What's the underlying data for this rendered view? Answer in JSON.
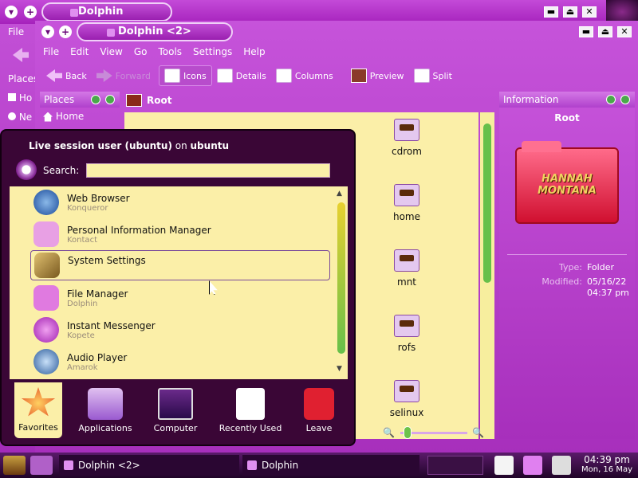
{
  "colors": {
    "accent": "#b42cc8",
    "panel_bg": "#fbefa8",
    "menu_bg": "#3a0636"
  },
  "back_window": {
    "title": "Dolphin",
    "menu_file": "File",
    "places_label": "Places",
    "places_items": [
      "Ho",
      "Ne"
    ]
  },
  "front_window": {
    "title": "Dolphin <2>",
    "menubar": [
      "File",
      "Edit",
      "View",
      "Go",
      "Tools",
      "Settings",
      "Help"
    ],
    "toolbar": {
      "back": "Back",
      "forward": "Forward",
      "icons": "Icons",
      "details": "Details",
      "columns": "Columns",
      "preview": "Preview",
      "split": "Split"
    },
    "places": {
      "title": "Places",
      "items": [
        "Home"
      ]
    },
    "location": "Root",
    "files": [
      "cdrom",
      "home",
      "mnt",
      "rofs",
      "selinux"
    ],
    "info": {
      "title": "Information",
      "name": "Root",
      "thumbnail_text": "HANNAH MONTANA",
      "type_label": "Type:",
      "type_value": "Folder",
      "modified_label": "Modified:",
      "modified_date": "05/16/22",
      "modified_time": "04:37 pm"
    }
  },
  "launcher": {
    "user_line_bold1": "Live session user (ubuntu)",
    "user_line_on": " on ",
    "user_line_bold2": "ubuntu",
    "search_label": "Search:",
    "search_value": "",
    "items": [
      {
        "title": "Web Browser",
        "subtitle": "Konqueror",
        "icon": "globe-icon",
        "color": "#3d6fb6"
      },
      {
        "title": "Personal Information Manager",
        "subtitle": "Kontact",
        "icon": "kontact-icon",
        "color": "#d47ad0"
      },
      {
        "title": "System Settings",
        "subtitle": "",
        "icon": "wrench-icon",
        "color": "#c8a060"
      },
      {
        "title": "File Manager",
        "subtitle": "Dolphin",
        "icon": "folder-icon",
        "color": "#d468d6"
      },
      {
        "title": "Instant Messenger",
        "subtitle": "Kopete",
        "icon": "chat-icon",
        "color": "#c03ad0"
      },
      {
        "title": "Audio Player",
        "subtitle": "Amarok",
        "icon": "amarok-icon",
        "color": "#3c78b4"
      }
    ],
    "tabs": [
      "Favorites",
      "Applications",
      "Computer",
      "Recently Used",
      "Leave"
    ]
  },
  "taskbar": {
    "tasks": [
      "Dolphin <2>",
      "Dolphin"
    ],
    "time": "04:39 pm",
    "date": "Mon, 16 May"
  }
}
